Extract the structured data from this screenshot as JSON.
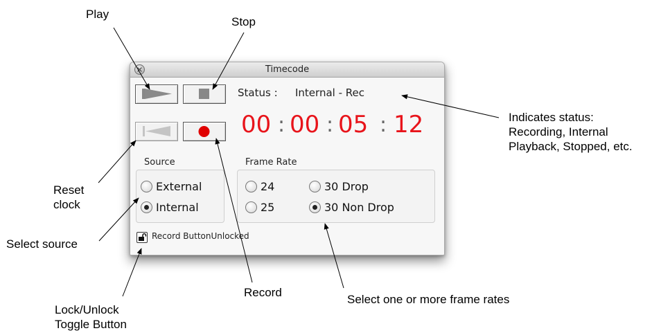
{
  "window": {
    "title": "Timecode",
    "status_label": "Status :",
    "status_value": "Internal - Rec",
    "timecode": {
      "hours": "00",
      "minutes": "00",
      "seconds": "05",
      "frames": "12",
      "separator": ":"
    },
    "source": {
      "label": "Source",
      "options": [
        "External",
        "Internal"
      ],
      "selected": "Internal"
    },
    "frame_rate": {
      "label": "Frame Rate",
      "options": [
        "24",
        "30 Drop",
        "25",
        "30 Non Drop"
      ],
      "selected": "30 Non Drop"
    },
    "lock_label": "Record ButtonUnlocked",
    "buttons": {
      "play": "play-icon",
      "stop": "stop-icon",
      "reset": "reset-clock-icon",
      "record": "record-icon",
      "lock": "unlock-icon"
    }
  },
  "annotations": {
    "play": "Play",
    "stop": "Stop",
    "status_line1": "Indicates status:",
    "status_line2": "Recording, Internal",
    "status_line3": "Playback, Stopped, etc.",
    "reset_line1": "Reset",
    "reset_line2": "clock",
    "select_source": "Select source",
    "record": "Record",
    "frame_rates": "Select one or more frame rates",
    "lock_line1": "Lock/Unlock",
    "lock_line2": "Toggle Button"
  },
  "colors": {
    "timecode": "#e8141b",
    "record": "#e00000",
    "separator": "#666666"
  }
}
